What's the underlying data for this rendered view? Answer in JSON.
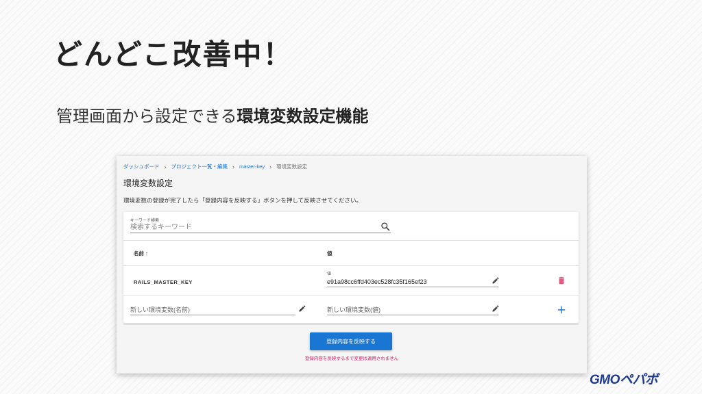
{
  "slide": {
    "title": "どんどこ改善中！",
    "subtitle_plain": "管理画面から設定できる",
    "subtitle_emphasis": "環境変数設定機能"
  },
  "breadcrumb": [
    "ダッシュボード",
    "プロジェクト一覧・編集",
    "master-key",
    "環境変数設定"
  ],
  "page": {
    "heading": "環境変数設定",
    "description": "環境変数の登録が完了したら「登録内容を反映する」ボタンを押して反映させてください。"
  },
  "search": {
    "label": "キーワード検索",
    "placeholder": "検索するキーワード",
    "value": ""
  },
  "table": {
    "col_name": "名前",
    "sort_indicator": "↑",
    "col_value": "値",
    "rows": [
      {
        "key": "RAILS_MASTER_KEY",
        "value_label": "値",
        "value": "e91a98cc6ffd403ec528fc35f165ef23"
      }
    ],
    "new_row": {
      "name_placeholder": "新しい環境変数(名前)",
      "value_placeholder": "新しい環境変数(値)"
    }
  },
  "actions": {
    "submit_label": "登録内容を反映する",
    "warning": "登録内容を反映するまで変更は適用されません"
  },
  "brand": {
    "logo_text": "GMOペパボ"
  },
  "colors": {
    "accent": "#1976d2",
    "danger": "#e05b7f",
    "warning_text": "#d81b60",
    "add_icon": "#1976d2"
  },
  "icons": [
    "search-icon",
    "pencil-icon",
    "trash-icon",
    "plus-icon",
    "chevron-right-icon",
    "sort-arrow-up-icon"
  ]
}
